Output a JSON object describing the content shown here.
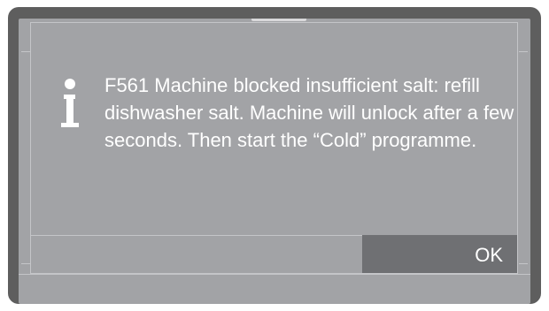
{
  "dialog": {
    "icon": "info-icon",
    "message": "F561 Machine blocked insufficient salt: refill dishwasher salt. Machine will unlock after a few seconds. Then start the “Cold” programme.",
    "ok_label": "OK"
  },
  "colors": {
    "frame": "#5e5e5e",
    "screen": "#a2a3a6",
    "button": "#6f7073",
    "text": "#ffffff",
    "outline": "#c4c5c8"
  }
}
